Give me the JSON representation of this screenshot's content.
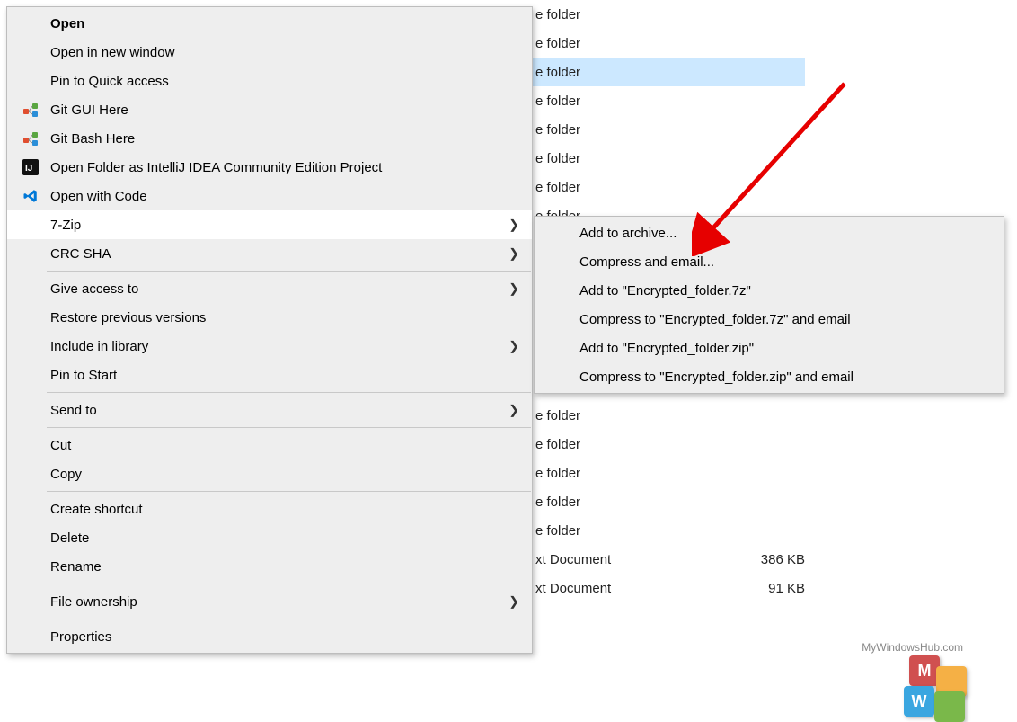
{
  "file_list": {
    "rows": [
      {
        "label": "e folder",
        "selected": false
      },
      {
        "label": "e folder",
        "selected": false
      },
      {
        "label": "e folder",
        "selected": true
      },
      {
        "label": "e folder",
        "selected": false
      },
      {
        "label": "e folder",
        "selected": false
      },
      {
        "label": "e folder",
        "selected": false
      },
      {
        "label": "e folder",
        "selected": false
      },
      {
        "label": "e folder",
        "selected": false
      }
    ]
  },
  "file_list_continued": {
    "rows": [
      {
        "label": "e folder"
      },
      {
        "label": "e folder"
      },
      {
        "label": "e folder"
      },
      {
        "label": "e folder"
      },
      {
        "label": "e folder"
      }
    ],
    "docs": [
      {
        "type": "xt Document",
        "size": "386 KB"
      },
      {
        "type": "xt Document",
        "size": "91 KB"
      }
    ]
  },
  "context_menu": {
    "items": [
      {
        "label": "Open",
        "bold": true
      },
      {
        "label": "Open in new window"
      },
      {
        "label": "Pin to Quick access"
      },
      {
        "label": "Git GUI Here",
        "icon": "git-gui"
      },
      {
        "label": "Git Bash Here",
        "icon": "git-bash"
      },
      {
        "label": "Open Folder as IntelliJ IDEA Community Edition Project",
        "icon": "intellij"
      },
      {
        "label": "Open with Code",
        "icon": "vscode"
      },
      {
        "label": "7-Zip",
        "submenu": true,
        "highlight": true
      },
      {
        "label": "CRC SHA",
        "submenu": true
      },
      {
        "sep": true
      },
      {
        "label": "Give access to",
        "submenu": true
      },
      {
        "label": "Restore previous versions"
      },
      {
        "label": "Include in library",
        "submenu": true
      },
      {
        "label": "Pin to Start"
      },
      {
        "sep": true
      },
      {
        "label": "Send to",
        "submenu": true
      },
      {
        "sep": true
      },
      {
        "label": "Cut"
      },
      {
        "label": "Copy"
      },
      {
        "sep": true
      },
      {
        "label": "Create shortcut"
      },
      {
        "label": "Delete"
      },
      {
        "label": "Rename"
      },
      {
        "sep": true
      },
      {
        "label": "File ownership",
        "submenu": true
      },
      {
        "sep": true
      },
      {
        "label": "Properties"
      }
    ]
  },
  "submenu_7zip": {
    "items": [
      {
        "label": "Add to archive..."
      },
      {
        "label": "Compress and email..."
      },
      {
        "label": "Add to \"Encrypted_folder.7z\""
      },
      {
        "label": "Compress to \"Encrypted_folder.7z\" and email"
      },
      {
        "label": "Add to \"Encrypted_folder.zip\""
      },
      {
        "label": "Compress to \"Encrypted_folder.zip\" and email"
      }
    ]
  },
  "watermark": {
    "text": "MyWindowsHub.com"
  }
}
